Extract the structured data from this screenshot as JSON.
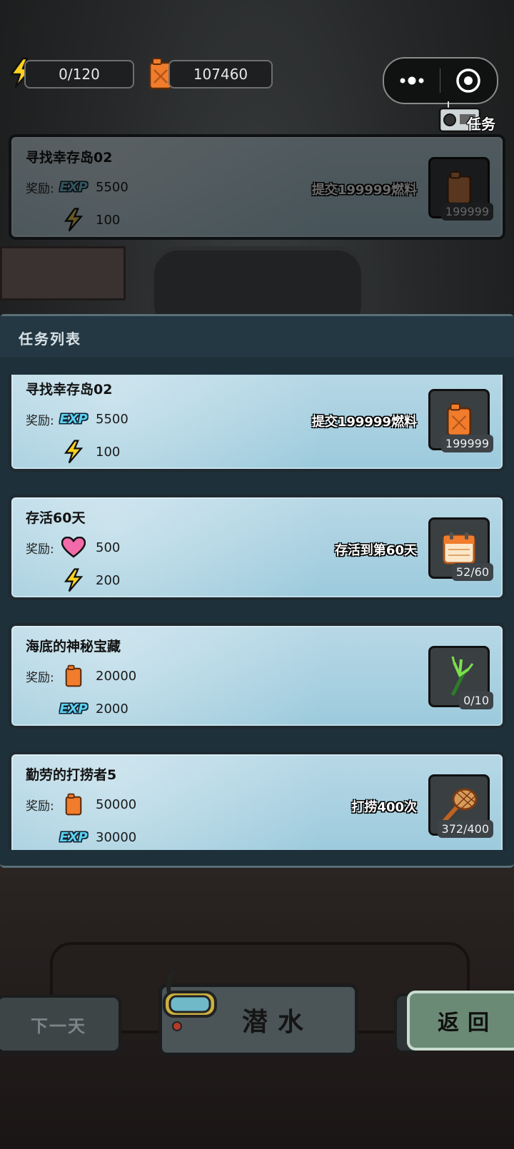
{
  "hud": {
    "energy": "0/120",
    "fuel": "107460"
  },
  "top_actions": {
    "more_label": "•●•",
    "task_label": "任务"
  },
  "background_card": {
    "title": "寻找幸存岛02",
    "reward_label": "奖励:",
    "exp_label": "EXP",
    "exp_value": "5500",
    "energy_value": "100",
    "requirement": "提交199999燃料",
    "count": "199999"
  },
  "panel": {
    "title": "任务列表"
  },
  "quests": [
    {
      "title": "寻找幸存岛02",
      "reward_label": "奖励:",
      "rewards": [
        {
          "icon": "exp-icon",
          "label": "EXP",
          "value": "5500"
        },
        {
          "icon": "lightning-icon",
          "label": "",
          "value": "100"
        }
      ],
      "requirement": "提交199999燃料",
      "item_icon": "fuel-can-icon",
      "count": "199999"
    },
    {
      "title": "存活60天",
      "reward_label": "奖励:",
      "rewards": [
        {
          "icon": "heart-icon",
          "label": "",
          "value": "500"
        },
        {
          "icon": "lightning-icon",
          "label": "",
          "value": "200"
        }
      ],
      "requirement": "存活到第60天",
      "item_icon": "calendar-icon",
      "count": "52/60"
    },
    {
      "title": "海底的神秘宝藏",
      "reward_label": "奖励:",
      "rewards": [
        {
          "icon": "fuel-can-icon",
          "label": "",
          "value": "20000"
        },
        {
          "icon": "exp-icon",
          "label": "EXP",
          "value": "2000"
        }
      ],
      "requirement": "",
      "item_icon": "trident-icon",
      "count": "0/10"
    },
    {
      "title": "勤劳的打捞者5",
      "reward_label": "奖励:",
      "rewards": [
        {
          "icon": "fuel-can-icon",
          "label": "",
          "value": "50000"
        },
        {
          "icon": "exp-icon",
          "label": "EXP",
          "value": "30000"
        }
      ],
      "requirement": "打捞400次",
      "item_icon": "net-icon",
      "count": "372/400"
    }
  ],
  "buttons": {
    "next_day": "下一天",
    "dive": "潜水",
    "back": "返回"
  },
  "colors": {
    "card_bg": "#b7d8e6",
    "panel_bg": "#1e3039",
    "exp_accent": "#5bd1ee",
    "back_button": "#6b8a75"
  }
}
